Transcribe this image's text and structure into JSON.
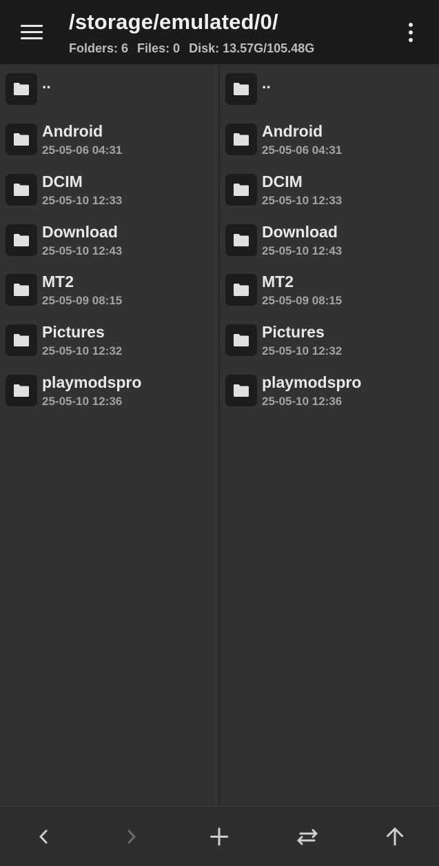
{
  "header": {
    "menu_icon": "hamburger-menu-icon",
    "path": "/storage/emulated/0/",
    "stats": {
      "folders": "Folders: 6",
      "files": "Files: 0",
      "disk": "Disk: 13.57G/105.48G"
    },
    "more_icon": "more-vertical-icon"
  },
  "panes": {
    "left": {
      "parent": "..",
      "items": [
        {
          "name": "Android",
          "date": "25-05-06 04:31"
        },
        {
          "name": "DCIM",
          "date": "25-05-10 12:33"
        },
        {
          "name": "Download",
          "date": "25-05-10 12:43"
        },
        {
          "name": "MT2",
          "date": "25-05-09 08:15"
        },
        {
          "name": "Pictures",
          "date": "25-05-10 12:32"
        },
        {
          "name": "playmodspro",
          "date": "25-05-10 12:36"
        }
      ]
    },
    "right": {
      "parent": "..",
      "items": [
        {
          "name": "Android",
          "date": "25-05-06 04:31"
        },
        {
          "name": "DCIM",
          "date": "25-05-10 12:33"
        },
        {
          "name": "Download",
          "date": "25-05-10 12:43"
        },
        {
          "name": "MT2",
          "date": "25-05-09 08:15"
        },
        {
          "name": "Pictures",
          "date": "25-05-10 12:32"
        },
        {
          "name": "playmodspro",
          "date": "25-05-10 12:36"
        }
      ]
    }
  },
  "bottom_bar": {
    "buttons": [
      {
        "icon": "back-chevron-icon",
        "enabled": true
      },
      {
        "icon": "forward-chevron-icon",
        "enabled": false
      },
      {
        "icon": "plus-icon",
        "enabled": true
      },
      {
        "icon": "swap-arrows-icon",
        "enabled": true
      },
      {
        "icon": "arrow-up-icon",
        "enabled": true
      }
    ]
  },
  "colors": {
    "header_bg": "#1b1b1b",
    "pane_bg": "#323232",
    "folder_tile_bg": "#1c1c1c",
    "folder_icon": "#e0e0e0",
    "name_text": "#e8e8e8",
    "date_text": "#a3a3a3"
  }
}
